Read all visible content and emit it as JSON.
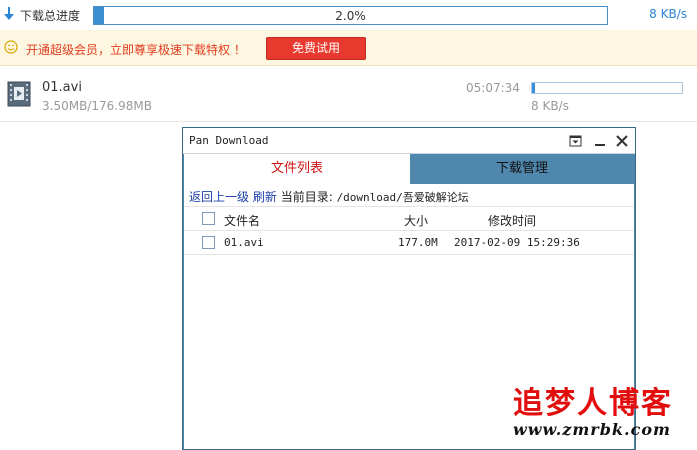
{
  "top": {
    "label": "下载总进度",
    "percent_text": "2.0%",
    "progress": 0.02,
    "speed": "8 KB/s"
  },
  "banner": {
    "text": "开通超级会员，立即尊享极速下载特权 ！",
    "button_label": "免费试用"
  },
  "item": {
    "name": "01.avi",
    "size": "3.50MB/176.98MB",
    "time_left": "05:07:34",
    "speed": "8 KB/s",
    "progress": 0.02
  },
  "pan_window": {
    "title": "Pan Download",
    "tabs": [
      {
        "label": "文件列表"
      },
      {
        "label": "下载管理"
      }
    ],
    "nav": {
      "up": "返回上一级",
      "refresh": "刷新",
      "current_label": "当前目录:",
      "path": "/download/吾爱破解论坛"
    },
    "columns": {
      "name": "文件名",
      "size": "大小",
      "mtime": "修改时间"
    },
    "files": [
      {
        "name": "01.avi",
        "size": "177.0M",
        "mtime": "2017-02-09 15:29:36"
      }
    ]
  },
  "watermark": {
    "title": "追梦人博客",
    "url": "www.zmrbk.com"
  },
  "colors": {
    "accent": "#3d8fd1",
    "banner_text": "#e03c1f",
    "button": "#e8392e",
    "window_frame": "#4f87ad",
    "active_tab_text": "#d01414"
  }
}
